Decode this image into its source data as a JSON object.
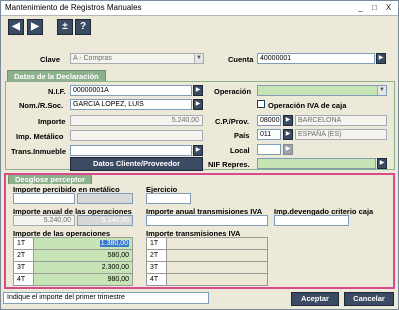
{
  "window": {
    "title": "Mantenimiento de Registros Manuales",
    "min": "_",
    "max": "□",
    "close": "X"
  },
  "toolbar": {
    "prev": "◀",
    "next": "▶",
    "plus_minus": "±",
    "help": "?"
  },
  "header": {
    "clave_label": "Clave",
    "clave_value": "A - Compras",
    "cuenta_label": "Cuenta",
    "cuenta_value": "40000001"
  },
  "declaracion": {
    "title": "Datos de la Declaración",
    "nif_label": "N.I.F.",
    "nif_value": "00000001A",
    "nom_label": "Nom./R.Soc.",
    "nom_value": "GARCIA LOPEZ, LUIS",
    "importe_label": "Importe",
    "importe_value": "5.240,00",
    "imp_metalico_label": "Imp. Metálico",
    "trans_label": "Trans.Inmueble",
    "operacion_label": "Operación",
    "operacion_iva_label": "Operación IVA de caja",
    "cp_label": "C.P./Prov.",
    "cp_value": "08000",
    "prov_value": "BARCELONA",
    "pais_label": "País",
    "pais_code": "011",
    "pais_value": "ESPAÑA (ES)",
    "local_label": "Local",
    "nif_repres_label": "NIF Repres.",
    "datos_btn": "Datos Cliente/Proveedor"
  },
  "desglose": {
    "title": "Desglose perceptor",
    "percibido_label": "Importe percibido en metálico",
    "ejercicio_label": "Ejercicio",
    "anual_label": "Importe anual de las operaciones",
    "anual_value1": "5.240,00",
    "anual_value2": "5.240,00",
    "anual_trans_label": "Importe anual transmisiones IVA",
    "devengado_label": "Imp.devengado criterio caja",
    "ops_label": "Importe de las operaciones",
    "trans_iva_label": "Importe transmisiones IVA",
    "ops_rows": [
      {
        "q": "1T",
        "v": "1.380,00"
      },
      {
        "q": "2T",
        "v": "580,00"
      },
      {
        "q": "3T",
        "v": "2.300,00"
      },
      {
        "q": "4T",
        "v": "980,00"
      }
    ],
    "trans_rows": [
      {
        "q": "1T",
        "v": ""
      },
      {
        "q": "2T",
        "v": ""
      },
      {
        "q": "3T",
        "v": ""
      },
      {
        "q": "4T",
        "v": ""
      }
    ]
  },
  "status": {
    "message": "Indique el importe del primer trimestre"
  },
  "buttons": {
    "accept": "Aceptar",
    "cancel": "Cancelar"
  }
}
